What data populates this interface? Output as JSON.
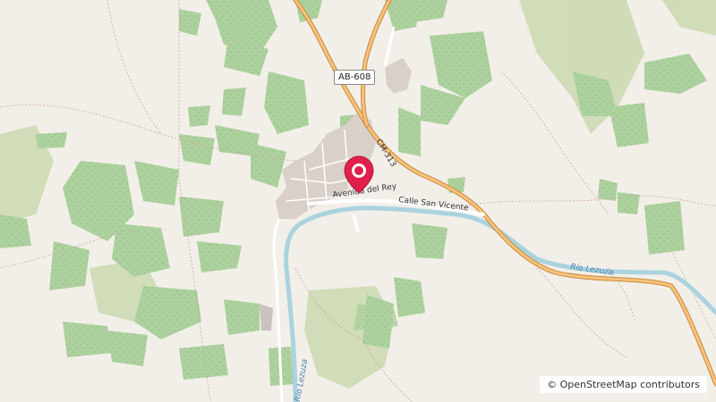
{
  "map": {
    "roads": {
      "ab608": "AB-608",
      "cm313": "CM-313",
      "avenida": "Avenida del Rey",
      "calle_san_vicente": "Calle San Vicente"
    },
    "rivers": {
      "lezuza_east": "Río Lezuza",
      "lezuza_south": "Río Lezuza"
    },
    "attribution": "© OpenStreetMap contributors",
    "marker": {
      "icon": "map-pin-icon",
      "color": "#e0204a"
    },
    "colors": {
      "land": "#f2efe9",
      "forest": "#add19e",
      "scrub": "#c8d7ab",
      "highway": "#f6c27c",
      "highway_casing": "#c98a3c",
      "river": "#aad3df",
      "town": "#d9d0c9"
    }
  }
}
